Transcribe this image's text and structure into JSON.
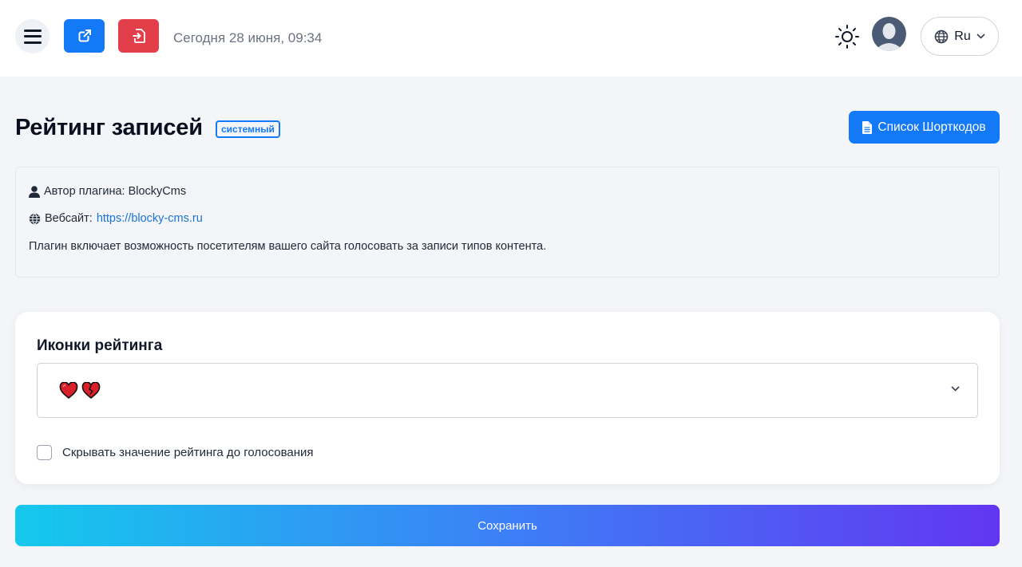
{
  "header": {
    "date_text": "Сегодня 28 июня, 09:34",
    "language": "Ru",
    "accent_colors": {
      "open_site": "#1479f7",
      "exit": "#e33f4a"
    },
    "icons": [
      "menu-icon",
      "external-link-icon",
      "sign-in-icon",
      "sun-icon",
      "avatar-icon",
      "globe-icon",
      "chevron-down-icon"
    ]
  },
  "page": {
    "title": "Рейтинг записей",
    "badge": "системный",
    "shortcodes_button": "Список Шорткодов"
  },
  "info": {
    "author_label": "Автор плагина: BlockyCms",
    "website_label": "Вебсайт:",
    "website_url": "https://blocky-cms.ru",
    "description": "Плагин включает возможность посетителям вашего сайта голосовать за записи типов контента."
  },
  "settings": {
    "icons_title": "Иконки рейтинга",
    "icons_selected": [
      "heart",
      "heart-broken"
    ],
    "hide_value_label": "Скрывать значение рейтинга до голосования",
    "hide_value_checked": false
  },
  "save_button": "Сохранить",
  "gradient": [
    "#14c9ec",
    "#3b82f6",
    "#6236f1"
  ]
}
